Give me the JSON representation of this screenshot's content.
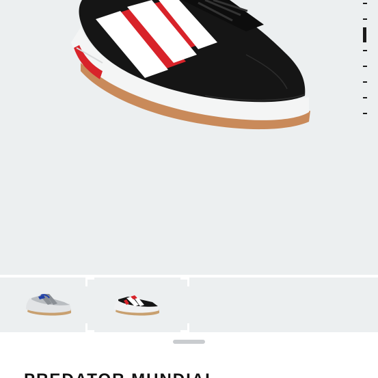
{
  "product": {
    "title": "PREDATOR MUNDIAL"
  },
  "hero_image": {
    "icon": "black-white-red-sneaker-image",
    "background_color": "#eceff0"
  },
  "gallery": {
    "image_count": 8,
    "current_image": 3,
    "thumbnails": [
      {
        "icon": "grey-blue-sneaker-thumbnail",
        "selected": false
      },
      {
        "icon": "black-white-red-sneaker-thumbnail",
        "selected": true
      }
    ]
  },
  "colors": {
    "accent": "#111111",
    "selection_frame": "#ffffff",
    "shoe_red": "#d8232a"
  }
}
